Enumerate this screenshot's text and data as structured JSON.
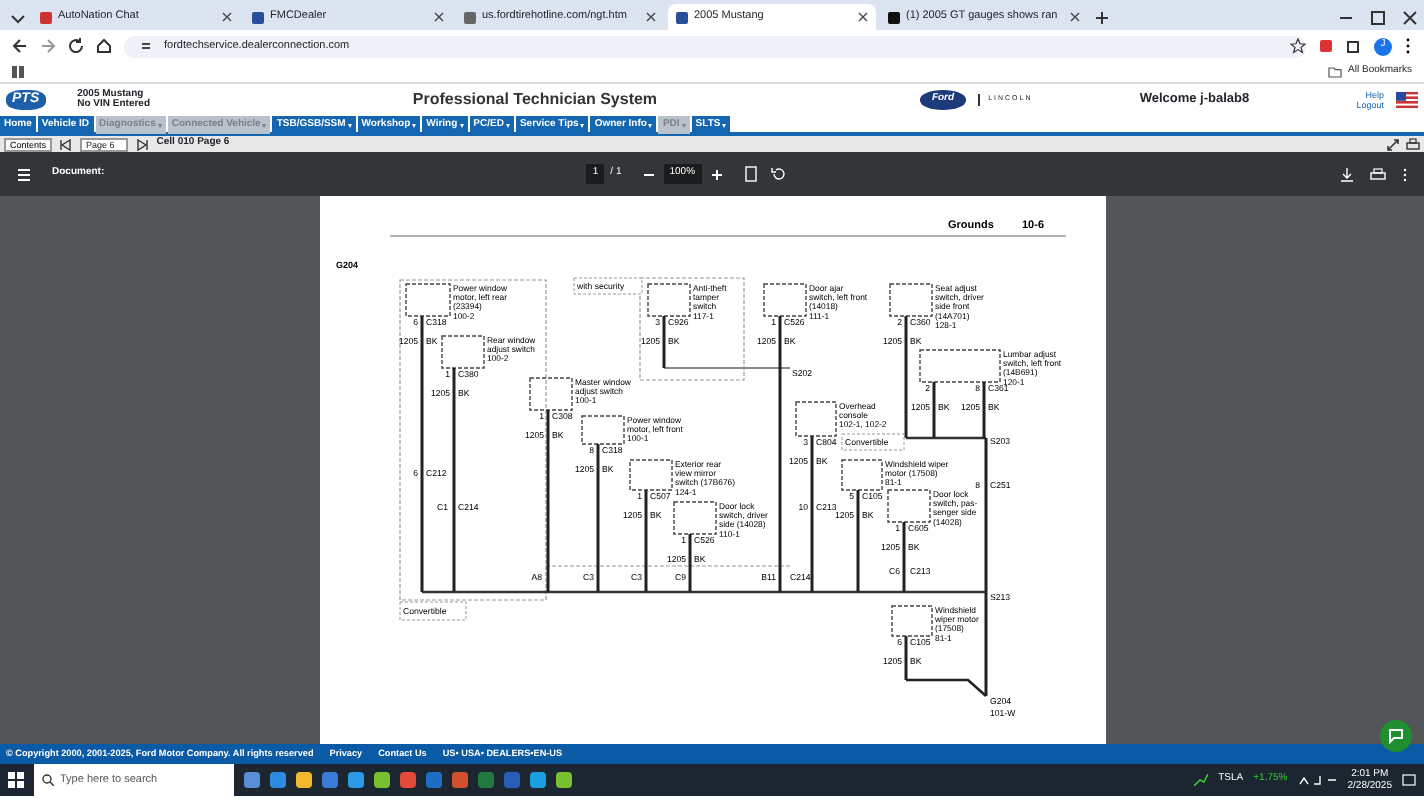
{
  "browser": {
    "tabs": [
      {
        "title": "AutoNation Chat",
        "selected": false
      },
      {
        "title": "FMCDealer",
        "selected": false
      },
      {
        "title": "us.fordtirehotline.com/ngt.htm",
        "selected": false
      },
      {
        "title": "2005 Mustang",
        "selected": true
      },
      {
        "title": "(1) 2005 GT gauges shows ran",
        "selected": false
      }
    ],
    "url": "fordtechservice.dealerconnection.com",
    "profile": "J",
    "bookmarks_label": "All Bookmarks"
  },
  "app_header": {
    "logo": "PTS",
    "vehicle": "2005 Mustang",
    "vin": "No VIN Entered",
    "title": "Professional Technician System",
    "ford_logo": "Ford",
    "lincoln_logo": "LINCOLN",
    "welcome": "Welcome j-balab8",
    "help": "Help",
    "logout": "Logout"
  },
  "nav": [
    {
      "label": "Home",
      "disabled": false,
      "has_menu": false
    },
    {
      "label": "Vehicle ID",
      "disabled": false,
      "has_menu": false
    },
    {
      "label": "Diagnostics",
      "disabled": true,
      "has_menu": true
    },
    {
      "label": "Connected Vehicle",
      "disabled": true,
      "has_menu": true
    },
    {
      "label": "TSB/GSB/SSM",
      "disabled": false,
      "has_menu": true
    },
    {
      "label": "Workshop",
      "disabled": false,
      "has_menu": true
    },
    {
      "label": "Wiring",
      "disabled": false,
      "has_menu": true
    },
    {
      "label": "PC/ED",
      "disabled": false,
      "has_menu": true
    },
    {
      "label": "Service Tips",
      "disabled": false,
      "has_menu": true
    },
    {
      "label": "Owner Info",
      "disabled": false,
      "has_menu": true
    },
    {
      "label": "PDI",
      "disabled": true,
      "has_menu": true
    },
    {
      "label": "SLTS",
      "disabled": false,
      "has_menu": true
    }
  ],
  "toolbar": {
    "contents": "Contents",
    "page_select": "Page 6",
    "cell": "Cell 010 Page 6"
  },
  "pdf_viewer": {
    "title": "Document:",
    "page": "1",
    "page_total": "/ 1",
    "zoom": "100%"
  },
  "document": {
    "section": "Grounds",
    "page_number": "10-6",
    "ground": "G204",
    "components": [
      {
        "lines": [
          "Power window",
          "motor, left rear",
          "(23394)",
          "100-2"
        ],
        "connector": "C318",
        "wires": [
          {
            "pin": "6",
            "circuit": "1205",
            "insulation": "BK"
          }
        ]
      },
      {
        "lines": [
          "Rear window",
          "adjust switch",
          "100-2"
        ],
        "connector": "C380",
        "wires": [
          {
            "pin": "1",
            "circuit": "1205",
            "insulation": "BK"
          }
        ]
      },
      {
        "lines": [
          "Anti-theft",
          "tamper",
          "switch",
          "117-1"
        ],
        "connector": "C926",
        "wires": [
          {
            "pin": "3",
            "circuit": "1205",
            "insulation": "BK"
          }
        ]
      },
      {
        "lines": [
          "Door ajar",
          "switch, left front",
          "(14018)",
          "111-1"
        ],
        "connector": "C526",
        "wires": [
          {
            "pin": "1",
            "circuit": "1205",
            "insulation": "BK"
          }
        ]
      },
      {
        "lines": [
          "Seat adjust",
          "switch, driver",
          "side front",
          "(14A701)",
          "128-1"
        ],
        "connector": "C360",
        "wires": [
          {
            "pin": "2",
            "circuit": "1205",
            "insulation": "BK"
          }
        ]
      },
      {
        "lines": [
          "Lumbar adjust",
          "switch, left front",
          "(14B691)",
          "120-1"
        ],
        "connector": "C361",
        "wires": [
          {
            "pin": "2",
            "circuit": "1205",
            "insulation": "BK"
          },
          {
            "pin": "8",
            "circuit": "1205",
            "insulation": "BK"
          }
        ]
      },
      {
        "lines": [
          "Master window",
          "adjust switch",
          "100-1"
        ],
        "connector": "C308",
        "wires": [
          {
            "pin": "1",
            "circuit": "1205",
            "insulation": "BK"
          }
        ]
      },
      {
        "lines": [
          "Power window",
          "motor, left front",
          "100-1"
        ],
        "connector": "C318",
        "wires": [
          {
            "pin": "8",
            "circuit": "1205",
            "insulation": "BK"
          }
        ]
      },
      {
        "lines": [
          "Overhead",
          "console",
          "102-1, 102-2"
        ],
        "connector": "C804",
        "wires": [
          {
            "pin": "3",
            "circuit": "1205",
            "insulation": "BK"
          }
        ]
      },
      {
        "lines": [
          "Exterior rear",
          "view mirror",
          "switch (17B676)",
          "124-1"
        ],
        "connector": "C507",
        "wires": [
          {
            "pin": "1",
            "circuit": "1205",
            "insulation": "BK"
          }
        ]
      },
      {
        "lines": [
          "Door lock",
          "switch, driver",
          "side (14028)",
          "110-1"
        ],
        "connector": "C526",
        "wires": [
          {
            "pin": "1",
            "circuit": "1205",
            "insulation": "BK"
          }
        ]
      },
      {
        "lines": [
          "Windshield wiper",
          "motor (17508)",
          "81-1"
        ],
        "connector": "C105",
        "wires": [
          {
            "pin": "5",
            "circuit": "1205",
            "insulation": "BK"
          }
        ]
      },
      {
        "lines": [
          "Door lock",
          "switch, pas-",
          "senger side",
          "(14028)"
        ],
        "connector": "C605",
        "wires": [
          {
            "pin": "1",
            "circuit": "1205",
            "insulation": "BK"
          }
        ]
      },
      {
        "lines": [
          "Windshield",
          "wiper motor",
          "(17508)",
          "81-1"
        ],
        "connector": "C105",
        "wires": [
          {
            "pin": "6",
            "circuit": "1205",
            "insulation": "BK"
          }
        ]
      }
    ],
    "tags": [
      "with security",
      "Convertible",
      "Convertible"
    ],
    "annotations": [
      "S202",
      "S203",
      "6",
      "C212",
      "8",
      "C251",
      "C1",
      "C214",
      "10",
      "C213",
      "C6",
      "C213",
      "A8",
      "C3",
      "C3",
      "C9",
      "B11",
      "C214",
      "S213",
      "G204",
      "101-W"
    ]
  },
  "footer": {
    "copyright": "© Copyright 2000, 2001-2025, Ford Motor Company. All rights reserved",
    "links": [
      "Privacy",
      "Contact Us",
      "US• USA• DEALERS•EN-US"
    ]
  },
  "taskbar": {
    "search_placeholder": "Type here to search",
    "stock": "TSLA",
    "change": "+1.75%",
    "time": "2:01 PM",
    "date": "2/28/2025"
  }
}
